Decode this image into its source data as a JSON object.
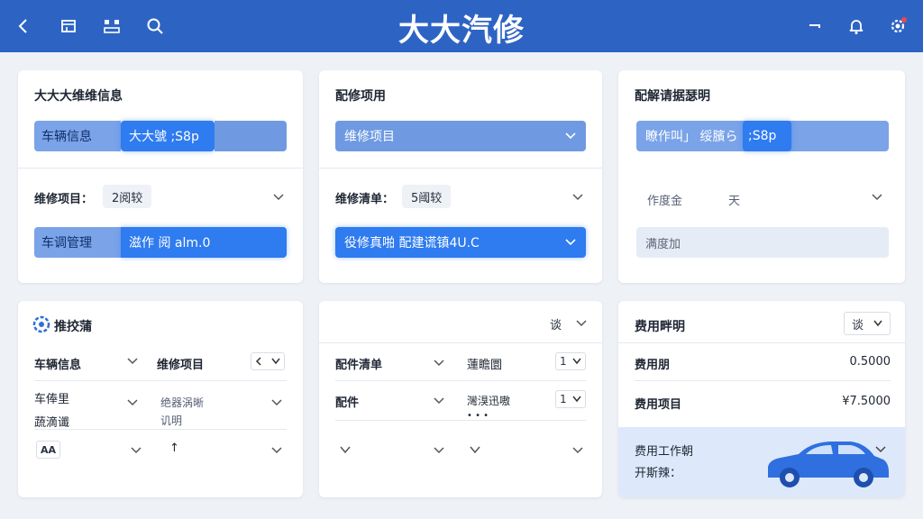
{
  "header": {
    "title": "大大汽修",
    "icons": [
      "back-icon",
      "calendar-icon",
      "grid-icon",
      "search-icon",
      "minimize-icon",
      "bell-icon",
      "settings-icon"
    ]
  },
  "card1": {
    "title": "大大大维维信息",
    "row1": {
      "label": "车辆信息",
      "value": "大大號 ;S8p"
    },
    "row2": {
      "label": "维修项目：",
      "value": "2阅较"
    },
    "row3": {
      "label": "车调管理",
      "value": "滋作 阅 alm.0"
    }
  },
  "card2": {
    "title": "配修项用",
    "select1": "维修项目",
    "row2": {
      "label": "维修清单：",
      "value": "5阈较"
    },
    "select2": "役修真啪  配建谎镇4U.C"
  },
  "card3": {
    "title": "配解请据瑟明",
    "row1": {
      "label": "瞭作叫」 绥臏ら",
      "value": ";S8p"
    },
    "row2": {
      "label": "作度金",
      "value": "天"
    },
    "input": "满度加"
  },
  "card4": {
    "title": "推挍蒲",
    "header_left": "车辆信息",
    "header_right": "维修项目",
    "row1_left": [
      "车俸里",
      "蔬滴谶"
    ],
    "row1_right": [
      "绝器涡晰",
      "讥明"
    ],
    "badge": "AA",
    "arrow": "↑"
  },
  "card5": {
    "select": "谈",
    "header_left": "配件清单",
    "header_right": "蓮瞻圜",
    "header_right_count": "1",
    "row1_left": "配件",
    "row1_right": "灣湨迅嗷",
    "row1_right_count": "1",
    "row2_right": "•  •  •"
  },
  "card6": {
    "title": "费用畔明",
    "select": "谈",
    "row1": {
      "label": "费用朋",
      "value": "0.5000"
    },
    "row2": {
      "label": "费用项目",
      "value": "¥7.5000"
    },
    "panel_line1": "费用工作朝",
    "panel_line2": "开斯辣："
  },
  "colors": {
    "header": "#2d64c4",
    "accent": "#2f76ea",
    "accent_light": "#6f9ae2",
    "panel": "#dde9fa",
    "background": "#eef1f6"
  }
}
